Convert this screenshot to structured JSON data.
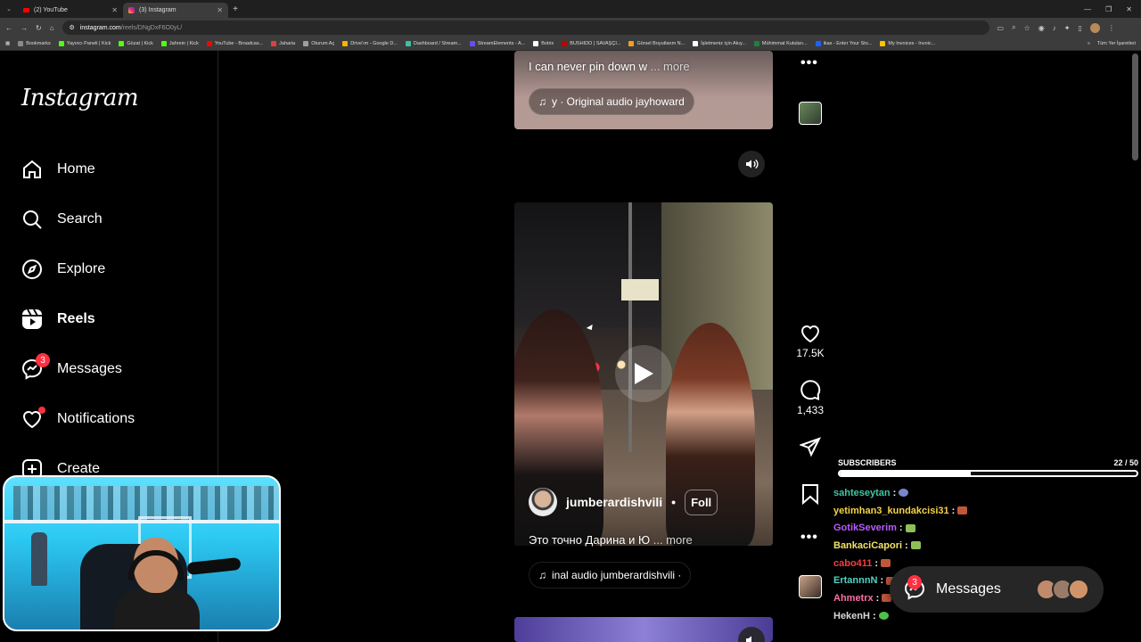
{
  "browser": {
    "tabs": [
      {
        "title": "(2) YouTube",
        "active": false
      },
      {
        "title": "(3) Instagram",
        "active": true
      }
    ],
    "address": {
      "domain": "instagram.com",
      "path": "/reels/DNgDxF6O0yL/"
    },
    "bookmarks": [
      {
        "label": "Bookmarks",
        "color": "#8a8a8a"
      },
      {
        "label": "Yayıncı Paneli | Kick",
        "color": "#53fc18"
      },
      {
        "label": "Gözat | Kick",
        "color": "#53fc18"
      },
      {
        "label": "Jahrein | Kick",
        "color": "#53fc18"
      },
      {
        "label": "YouTube - Broadcas...",
        "color": "#ff0000"
      },
      {
        "label": "Jaharia",
        "color": "#e04040"
      },
      {
        "label": "Oturum Aç",
        "color": "#9aa0a6"
      },
      {
        "label": "Drive'ım - Google D...",
        "color": "#f4b400"
      },
      {
        "label": "Dashboard / Stream...",
        "color": "#40c0a0"
      },
      {
        "label": "StreamElements - A...",
        "color": "#6a4cff"
      },
      {
        "label": "Botrix",
        "color": "#ffffff"
      },
      {
        "label": "BUSHIDO | SAVAŞÇI...",
        "color": "#c00000"
      },
      {
        "label": "Görsel Boyutlanm N...",
        "color": "#f0a020"
      },
      {
        "label": "İşletmeniz için Akıy...",
        "color": "#ffffff"
      },
      {
        "label": "Mühimmat Kutuları...",
        "color": "#208040"
      },
      {
        "label": "ikas - Enter Your Sto...",
        "color": "#2060ff"
      },
      {
        "label": "My Invoices - Invoic...",
        "color": "#f5c400"
      }
    ],
    "bookmarks_right": "Tüm Yer İşaretleri"
  },
  "instagram": {
    "logo": "Instagram",
    "nav": [
      {
        "label": "Home",
        "icon": "home-icon"
      },
      {
        "label": "Search",
        "icon": "search-icon"
      },
      {
        "label": "Explore",
        "icon": "explore-icon"
      },
      {
        "label": "Reels",
        "icon": "reels-icon",
        "active": true
      },
      {
        "label": "Messages",
        "icon": "messages-icon",
        "badge": "3"
      },
      {
        "label": "Notifications",
        "icon": "heart-icon",
        "dot": true
      },
      {
        "label": "Create",
        "icon": "plus-icon"
      }
    ],
    "reel_top": {
      "caption": "I can never pin down w",
      "more": "... more",
      "audio": "y · Original audio  jayhoward"
    },
    "reel_main": {
      "username": "jumberardishvili",
      "separator": "•",
      "follow": "Foll",
      "caption": "Это точно Дарина и Ю",
      "more": "... more",
      "audio": "inal audio  jumberardishvili ·",
      "likes": "17.5K",
      "comments": "1,433"
    }
  },
  "stream_overlay": {
    "subs_label": "SUBSCRIBERS",
    "subs_count": "22",
    "subs_goal": "/ 50",
    "subs_progress": 0.44,
    "chat": [
      {
        "user": "sahteseytan",
        "color": "#3fc7a3",
        "emote": "p"
      },
      {
        "user": "yetimhan3_kundakcisi31",
        "color": "#f5d24a",
        "emote": "r"
      },
      {
        "user": "GotikSeverim",
        "color": "#b85cff",
        "emote": "g"
      },
      {
        "user": "BankaciCapori",
        "color": "#f5e26a",
        "emote": "g"
      },
      {
        "user": "cabo411",
        "color": "#ff3b3b",
        "emote": "r"
      },
      {
        "user": "ErtannnN",
        "color": "#4fd3c4",
        "emote": "r"
      },
      {
        "user": "Ahmetrx",
        "color": "#ff6fa8",
        "emote": "r"
      },
      {
        "user": "HekenH",
        "color": "#d9d9d9",
        "emote": "l"
      }
    ],
    "chat_sep": ":"
  },
  "messages_pill": {
    "label": "Messages",
    "badge": "3"
  }
}
